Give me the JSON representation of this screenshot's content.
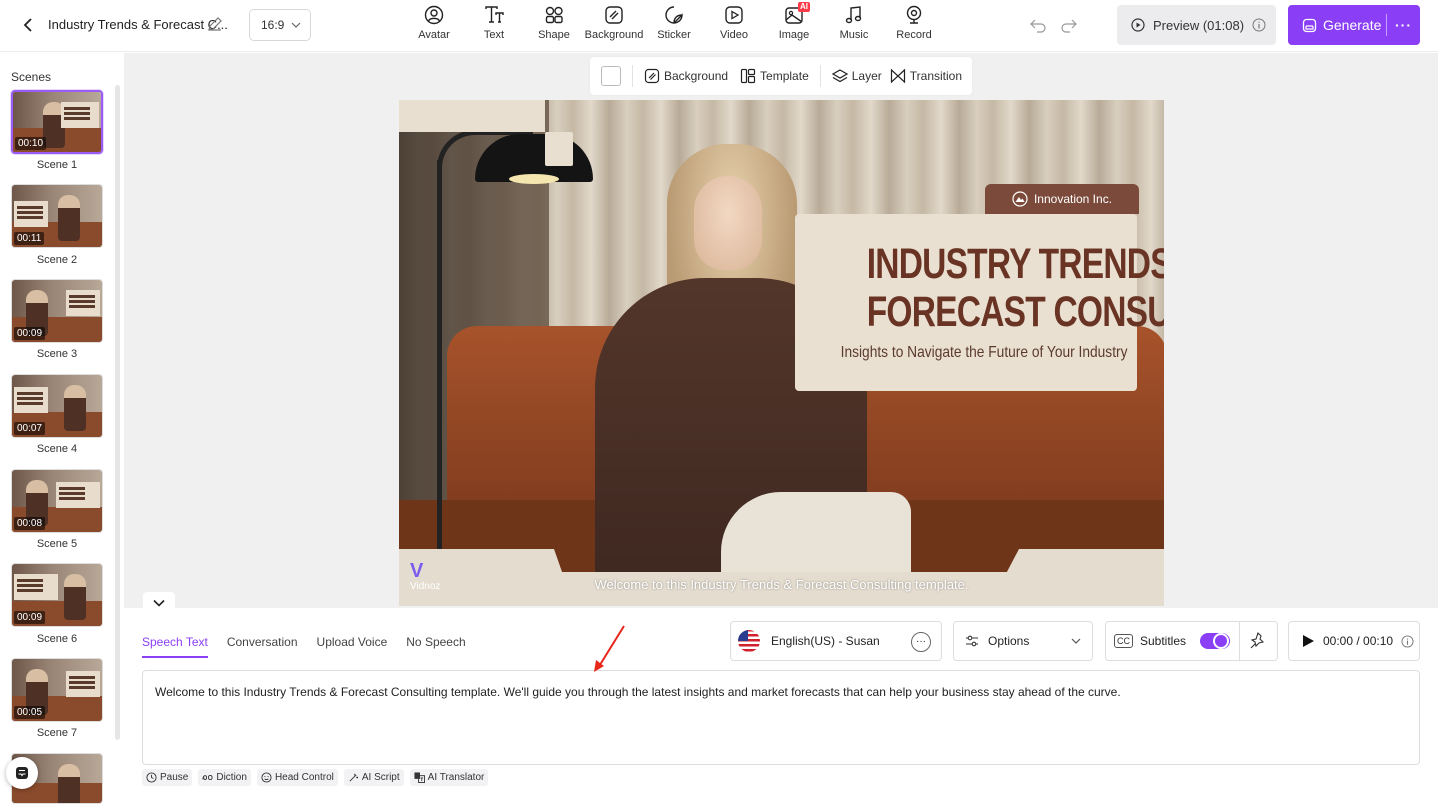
{
  "header": {
    "project_title": "Industry Trends & Forecast C...",
    "aspect_ratio": "16:9",
    "tools": [
      {
        "label": "Avatar",
        "icon": "avatar-icon"
      },
      {
        "label": "Text",
        "icon": "text-icon"
      },
      {
        "label": "Shape",
        "icon": "shape-icon"
      },
      {
        "label": "Background",
        "icon": "background-icon"
      },
      {
        "label": "Sticker",
        "icon": "sticker-icon"
      },
      {
        "label": "Video",
        "icon": "video-icon"
      },
      {
        "label": "Image",
        "icon": "image-icon",
        "badge": "AI"
      },
      {
        "label": "Music",
        "icon": "music-icon"
      },
      {
        "label": "Record",
        "icon": "record-icon"
      }
    ],
    "preview_label": "Preview (01:08)",
    "generate_label": "Generate",
    "more_label": "···"
  },
  "scenes": {
    "title": "Scenes",
    "items": [
      {
        "label": "Scene 1",
        "duration": "00:10",
        "active": true
      },
      {
        "label": "Scene 2",
        "duration": "00:11"
      },
      {
        "label": "Scene 3",
        "duration": "00:09"
      },
      {
        "label": "Scene 4",
        "duration": "00:07"
      },
      {
        "label": "Scene 5",
        "duration": "00:08"
      },
      {
        "label": "Scene 6",
        "duration": "00:09"
      },
      {
        "label": "Scene 7",
        "duration": "00:05"
      }
    ]
  },
  "canvas_toolbar": {
    "background_label": "Background",
    "template_label": "Template",
    "layer_label": "Layer",
    "transition_label": "Transition"
  },
  "video": {
    "company_tag": "Innovation Inc.",
    "title_line1": "INDUSTRY TRENDS &",
    "title_line2": "FORECAST CONSULTING",
    "subtitle": "Insights to Navigate the Future of Your Industry",
    "caption": "Welcome to this Industry Trends & Forecast Consulting template.",
    "watermark": "Vidnoz"
  },
  "script_panel": {
    "tabs": [
      "Speech Text",
      "Conversation",
      "Upload Voice",
      "No Speech"
    ],
    "active_tab": "Speech Text",
    "voice": "English(US) - Susan",
    "options_label": "Options",
    "subtitles_label": "Subtitles",
    "subtitles_on": true,
    "cc_label": "CC",
    "time": "00:00 / 00:10",
    "speech_text": "Welcome to this Industry Trends & Forecast Consulting template. We'll guide you through the latest insights and market forecasts that can help your business stay ahead of the curve.",
    "actions": [
      {
        "label": "Pause",
        "icon": "clock-icon"
      },
      {
        "label": "Diction",
        "icon": "diction-icon"
      },
      {
        "label": "Head Control",
        "icon": "face-icon"
      },
      {
        "label": "AI Script",
        "icon": "magic-wand-icon"
      },
      {
        "label": "AI Translator",
        "icon": "translate-icon"
      }
    ]
  },
  "colors": {
    "accent": "#8a3ef6",
    "title_brown": "#6a3425",
    "card_beige": "#eae0d1",
    "annotation_arrow": "#e8271c"
  }
}
